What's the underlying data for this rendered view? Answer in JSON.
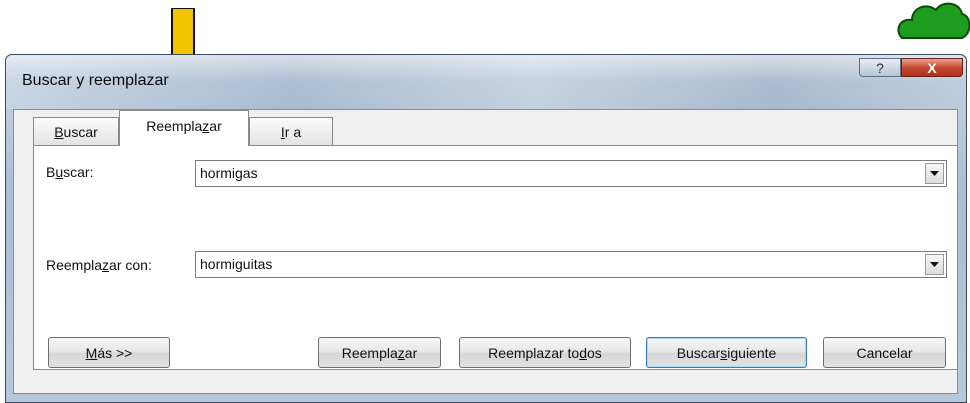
{
  "window": {
    "title": "Buscar y reemplazar",
    "help_glyph": "?",
    "close_glyph": "X"
  },
  "tabs": [
    {
      "pre": "",
      "ul": "B",
      "post": "uscar",
      "active": false
    },
    {
      "pre": "Reempla",
      "ul": "z",
      "post": "ar",
      "active": true
    },
    {
      "pre": "",
      "ul": "I",
      "post": "r a",
      "active": false
    }
  ],
  "fields": {
    "buscar": {
      "label_pre": "B",
      "label_ul": "u",
      "label_post": "scar:",
      "value": "hormigas"
    },
    "reemplazar": {
      "label_pre": "Reempla",
      "label_ul": "z",
      "label_post": "ar con:",
      "value": "hormiguitas"
    }
  },
  "buttons": {
    "mas": {
      "pre": "",
      "ul": "M",
      "post": "ás >>"
    },
    "reemplazar": {
      "pre": "Reempla",
      "ul": "z",
      "post": "ar"
    },
    "reemplazar_todos": {
      "pre": "Reemplazar to",
      "ul": "d",
      "post": "os"
    },
    "buscar_siguiente": {
      "pre": "Buscar ",
      "ul": "s",
      "post": "iguiente"
    },
    "cancelar": {
      "pre": "Cancelar",
      "ul": "",
      "post": ""
    }
  },
  "colors": {
    "arrow_fill": "#f5c400",
    "arrow_stroke": "#111111",
    "cloud_fill": "#1e9c1e"
  }
}
